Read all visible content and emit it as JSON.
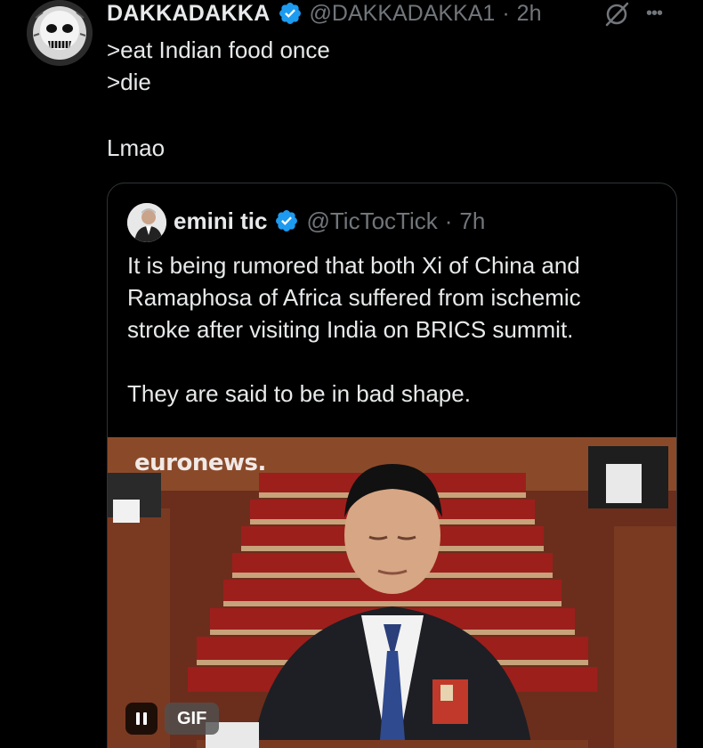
{
  "tweet": {
    "author_name": "DAKKADAKKA",
    "author_handle": "@DAKKADAKKA1",
    "separator": "·",
    "time": "2h",
    "lines": [
      ">eat Indian food once",
      ">die",
      "Lmao"
    ],
    "icons": {
      "verified": "verified-badge-icon",
      "grok": "grok-icon",
      "more": "more-icon"
    },
    "more_glyph": "•••"
  },
  "quote": {
    "author_name": "emini tic",
    "author_handle": "@TicTocTick",
    "separator": "·",
    "time": "7h",
    "paragraph1": [
      "It is being rumored that both Xi of China and",
      "Ramaphosa of Africa suffered from ischemic",
      "stroke after visiting India on BRICS summit."
    ],
    "paragraph2": [
      "They are said to be in bad shape."
    ],
    "media": {
      "watermark": "euronews.",
      "gif_label": "GIF",
      "pause_icon": "pause-icon"
    }
  },
  "colors": {
    "background": "#000000",
    "text": "#e7e9ea",
    "secondary": "#71767b",
    "verified_blue": "#1d9bf0",
    "border": "#2f3336"
  }
}
